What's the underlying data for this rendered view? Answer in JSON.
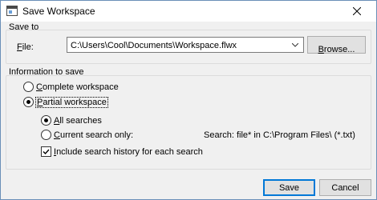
{
  "window": {
    "title": "Save Workspace"
  },
  "save_to": {
    "group_label": "Save to",
    "file_label_accel": "F",
    "file_label_rest": "ile:",
    "file_value": "C:\\Users\\Cool\\Documents\\Workspace.flwx",
    "browse_accel": "B",
    "browse_rest": "rowse..."
  },
  "info": {
    "group_label": "Information to save",
    "complete_accel": "C",
    "complete_rest": "omplete workspace",
    "complete_checked": false,
    "partial_accel": "P",
    "partial_rest": "artial workspace",
    "partial_checked": true,
    "all_accel": "A",
    "all_rest": "ll searches",
    "all_checked": true,
    "current_accel": "C",
    "current_rest": "urrent search only:",
    "current_checked": false,
    "search_text": "Search: file* in C:\\Program Files\\ (*.txt)",
    "history_accel": "I",
    "history_rest": "nclude search history for each search",
    "history_checked": true
  },
  "buttons": {
    "save": "Save",
    "cancel": "Cancel"
  }
}
